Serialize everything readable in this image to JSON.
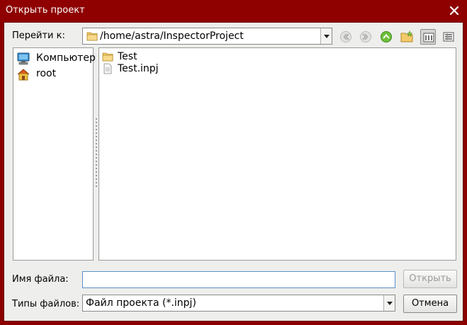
{
  "window": {
    "title": "Открыть проект"
  },
  "toolbar": {
    "lookin_label": "Перейти к:",
    "path": "/home/astra/InspectorProject",
    "icons": [
      "back-icon",
      "forward-icon",
      "up-icon",
      "new-folder-icon",
      "list-view-icon",
      "detail-view-icon"
    ]
  },
  "sidebar": {
    "items": [
      {
        "label": "Компьютер",
        "icon": "computer-icon"
      },
      {
        "label": "root",
        "icon": "home-icon"
      }
    ]
  },
  "files": [
    {
      "name": "Test",
      "icon": "folder-icon"
    },
    {
      "name": "Test.inpj",
      "icon": "file-icon"
    }
  ],
  "filename": {
    "label": "Имя файла:",
    "value": ""
  },
  "filetype": {
    "label": "Типы файлов:",
    "selected": "Файл проекта (*.inpj)"
  },
  "buttons": {
    "open": "Открыть",
    "cancel": "Отмена"
  },
  "colors": {
    "titlebar": "#8f0000",
    "client_bg": "#eeeeec",
    "input_border": "#5a8fc8"
  }
}
